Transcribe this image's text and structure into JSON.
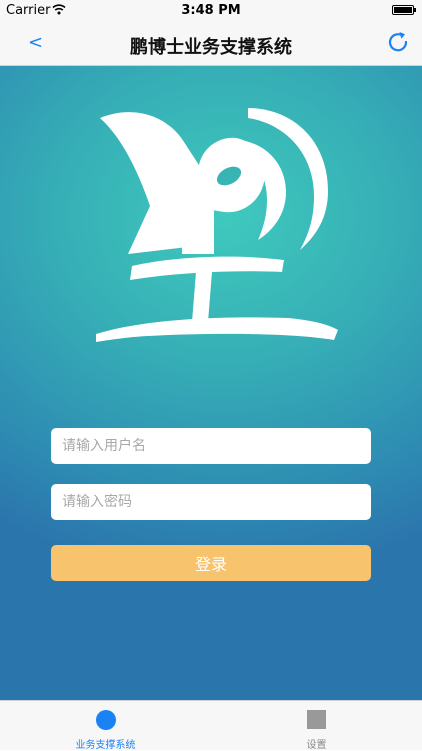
{
  "status_bar": {
    "carrier": "Carrier",
    "time": "3:48 PM"
  },
  "nav": {
    "back_label": "<",
    "title": "鹏博士业务支撑系统"
  },
  "login": {
    "username_placeholder": "请输入用户名",
    "password_placeholder": "请输入密码",
    "login_button_label": "登录"
  },
  "tab_bar": {
    "tabs": [
      {
        "label": "业务支撑系统",
        "active": true
      },
      {
        "label": "设置",
        "active": false
      }
    ]
  },
  "colors": {
    "accent": "#1a82f5",
    "login_button": "#f8c36d",
    "background_top": "#3fc9bd",
    "background_bottom": "#2b75ad"
  },
  "icons": [
    "wifi-icon",
    "battery-icon",
    "refresh-icon",
    "logo",
    "tab-circle-icon",
    "tab-square-icon"
  ]
}
